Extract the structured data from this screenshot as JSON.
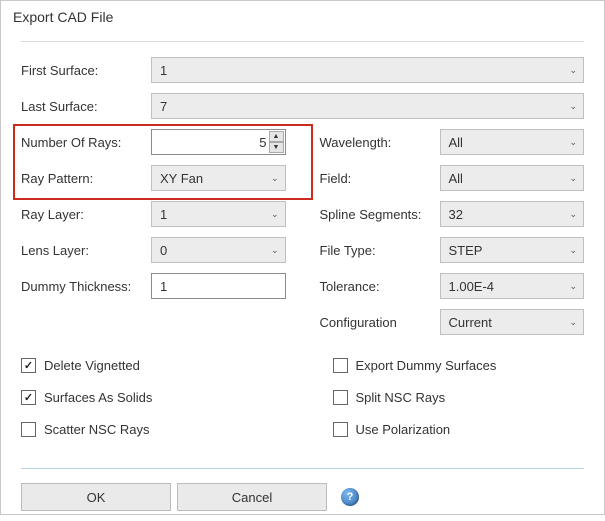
{
  "title": "Export CAD File",
  "left": {
    "first_surface": {
      "label": "First Surface:",
      "value": "1"
    },
    "last_surface": {
      "label": "Last Surface:",
      "value": "7"
    },
    "number_of_rays": {
      "label": "Number Of Rays:",
      "value": "5"
    },
    "ray_pattern": {
      "label": "Ray Pattern:",
      "value": "XY Fan"
    },
    "ray_layer": {
      "label": "Ray Layer:",
      "value": "1"
    },
    "lens_layer": {
      "label": "Lens Layer:",
      "value": "0"
    },
    "dummy_thickness": {
      "label": "Dummy Thickness:",
      "value": "1"
    }
  },
  "right": {
    "wavelength": {
      "label": "Wavelength:",
      "value": "All"
    },
    "field": {
      "label": "Field:",
      "value": "All"
    },
    "spline_segments": {
      "label": "Spline Segments:",
      "value": "32"
    },
    "file_type": {
      "label": "File Type:",
      "value": "STEP"
    },
    "tolerance": {
      "label": "Tolerance:",
      "value": "1.00E-4"
    },
    "configuration": {
      "label": "Configuration",
      "value": "Current"
    }
  },
  "checks": {
    "delete_vignetted": {
      "label": "Delete Vignetted",
      "checked": true
    },
    "surfaces_as_solids": {
      "label": "Surfaces As Solids",
      "checked": true
    },
    "scatter_nsc_rays": {
      "label": "Scatter NSC Rays",
      "checked": false
    },
    "export_dummy_surfaces": {
      "label": "Export Dummy Surfaces",
      "checked": false
    },
    "split_nsc_rays": {
      "label": "Split NSC Rays",
      "checked": false
    },
    "use_polarization": {
      "label": "Use Polarization",
      "checked": false
    }
  },
  "buttons": {
    "ok": "OK",
    "cancel": "Cancel"
  }
}
